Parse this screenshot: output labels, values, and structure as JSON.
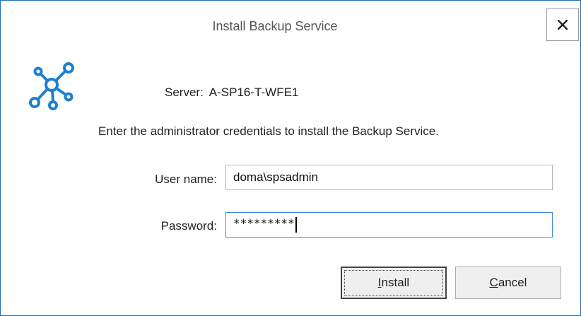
{
  "dialog": {
    "title": "Install Backup Service",
    "close_icon": "close-icon"
  },
  "app_icon": "network-nodes-icon",
  "accent_color": "#1e7fcf",
  "server": {
    "label": "Server:",
    "value": "A-SP16-T-WFE1"
  },
  "instruction": "Enter the administrator credentials to install the Backup Service.",
  "form": {
    "username_label": "User name:",
    "username_value": "doma\\spsadmin",
    "password_label": "Password:",
    "password_mask": "*********"
  },
  "buttons": {
    "install_mnemonic": "I",
    "install_rest": "nstall",
    "cancel_mnemonic": "C",
    "cancel_rest": "ancel"
  }
}
